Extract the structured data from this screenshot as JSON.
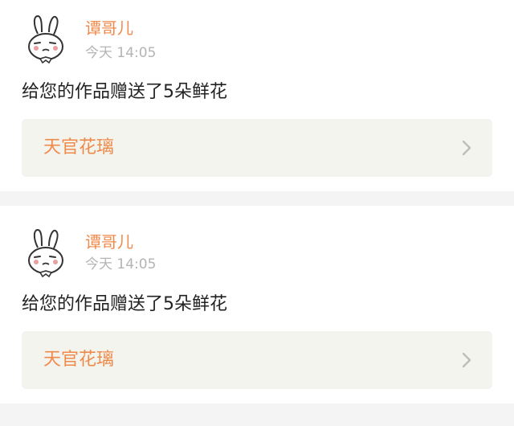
{
  "notifications": [
    {
      "user": {
        "name": "谭哥儿",
        "avatar_icon": "bunny-avatar-icon"
      },
      "time": "今天 14:05",
      "message": "给您的作品赠送了5朵鲜花",
      "work": {
        "title": "天官花璃",
        "chevron_icon": "chevron-right-icon"
      }
    },
    {
      "user": {
        "name": "谭哥儿",
        "avatar_icon": "bunny-avatar-icon"
      },
      "time": "今天 14:05",
      "message": "给您的作品赠送了5朵鲜花",
      "work": {
        "title": "天官花璃",
        "chevron_icon": "chevron-right-icon"
      }
    }
  ],
  "colors": {
    "accent": "#f08a4b",
    "timestamp": "#b4b4b4",
    "text": "#222222",
    "link_bg": "#f4f4ee",
    "page_bg": "#f4f4f4"
  }
}
